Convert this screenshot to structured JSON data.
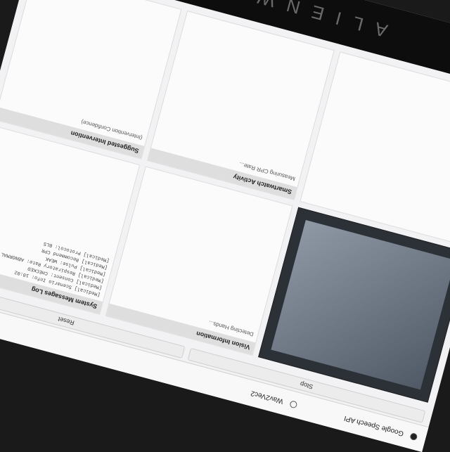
{
  "bezel": {
    "brand": "ALIENWARE"
  },
  "speech": {
    "option_label": "Google Speech API",
    "alt_label": "Wav2Vec2"
  },
  "buttons": {
    "stop": "Stop",
    "reset": "Reset"
  },
  "panels": {
    "vision": {
      "title": "Vision Information",
      "status": "Detecting Hands..."
    },
    "watch": {
      "title": "Smartwatch Activity",
      "status": "Measuring CPR Rate..."
    },
    "log": {
      "title": "System Messages Log"
    },
    "intervention": {
      "title": "Suggested Intervention",
      "status": "(Intervention Confidence)"
    }
  },
  "log_lines": [
    "[Medical] Scenario Info: 10:02",
    "[Medical] Consent: CHECKED",
    "[Medical] Respiratory Rate: ABNORMAL",
    "[Medical] Pulse: WEAK",
    "[Medical] Recommend CPR",
    "[Medical] Protocol: BLS"
  ]
}
